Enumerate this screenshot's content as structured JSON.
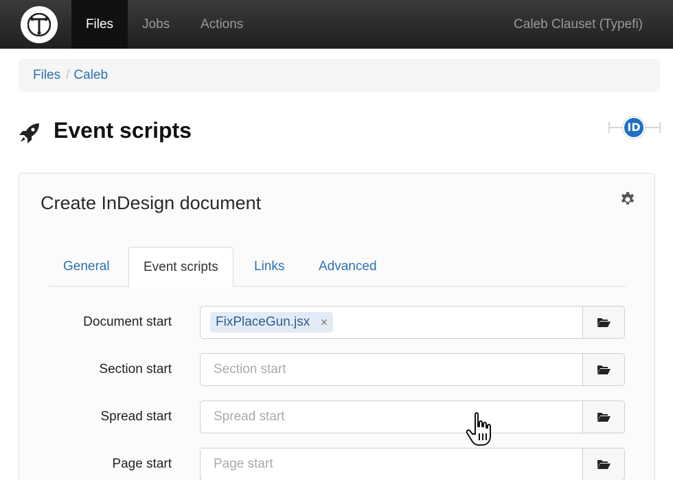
{
  "nav": {
    "files": "Files",
    "jobs": "Jobs",
    "actions": "Actions",
    "user": "Caleb Clauset (Typefi)"
  },
  "breadcrumb": {
    "items": [
      "Files",
      "Caleb"
    ],
    "separator": "/"
  },
  "page": {
    "title": "Event scripts",
    "badge": "ID"
  },
  "panel": {
    "title": "Create InDesign document",
    "tabs": [
      "General",
      "Event scripts",
      "Links",
      "Advanced"
    ],
    "active_tab": "Event scripts",
    "fields": [
      {
        "label": "Document start",
        "placeholder": "",
        "tag": "FixPlaceGun.jsx",
        "tag_remove": "×"
      },
      {
        "label": "Section start",
        "placeholder": "Section start"
      },
      {
        "label": "Spread start",
        "placeholder": "Spread start"
      },
      {
        "label": "Page start",
        "placeholder": "Page start"
      }
    ]
  },
  "colors": {
    "nav_bg": "#262626",
    "link": "#2c71b0",
    "badge": "#1f6fc4"
  }
}
